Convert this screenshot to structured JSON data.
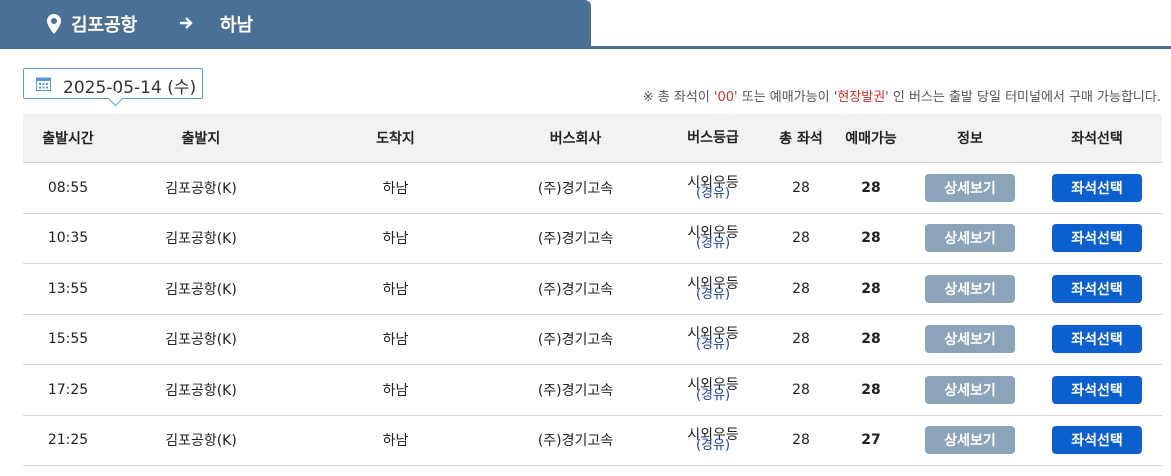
{
  "route": {
    "from": "김포공항",
    "to": "하남"
  },
  "date": {
    "value": "2025-05-14 (수)"
  },
  "notice": {
    "prefix": "※ 총 좌석이 '",
    "zero": "00",
    "middle": "' 또는 예매가능이 '",
    "onsite": "현장발권",
    "suffix": "' 인 버스는 출발 당일 터미널에서 구매 가능합니다."
  },
  "headers": {
    "time": "출발시간",
    "from": "출발지",
    "to": "도착지",
    "company": "버스회사",
    "grade": "버스등급",
    "total": "총 좌석",
    "available": "예매가능",
    "info": "정보",
    "select": "좌석선택"
  },
  "colors": {
    "route_bar": "#4a7096",
    "detail_button": "#8ca4b9",
    "seat_button": "#0b5fce",
    "notice_red": "#d12f2f",
    "via_blue": "#1f3faa"
  },
  "rows": [
    {
      "time": "08:55",
      "from": "김포공항(K)",
      "to": "하남",
      "company": "(주)경기고속",
      "grade": "시외우등",
      "via": "(경유)",
      "total": "28",
      "available": "28",
      "detail_label": "상세보기",
      "select_label": "좌석선택"
    },
    {
      "time": "10:35",
      "from": "김포공항(K)",
      "to": "하남",
      "company": "(주)경기고속",
      "grade": "시외우등",
      "via": "(경유)",
      "total": "28",
      "available": "28",
      "detail_label": "상세보기",
      "select_label": "좌석선택"
    },
    {
      "time": "13:55",
      "from": "김포공항(K)",
      "to": "하남",
      "company": "(주)경기고속",
      "grade": "시외우등",
      "via": "(경유)",
      "total": "28",
      "available": "28",
      "detail_label": "상세보기",
      "select_label": "좌석선택"
    },
    {
      "time": "15:55",
      "from": "김포공항(K)",
      "to": "하남",
      "company": "(주)경기고속",
      "grade": "시외우등",
      "via": "(경유)",
      "total": "28",
      "available": "28",
      "detail_label": "상세보기",
      "select_label": "좌석선택"
    },
    {
      "time": "17:25",
      "from": "김포공항(K)",
      "to": "하남",
      "company": "(주)경기고속",
      "grade": "시외우등",
      "via": "(경유)",
      "total": "28",
      "available": "28",
      "detail_label": "상세보기",
      "select_label": "좌석선택"
    },
    {
      "time": "21:25",
      "from": "김포공항(K)",
      "to": "하남",
      "company": "(주)경기고속",
      "grade": "시외우등",
      "via": "(경유)",
      "total": "28",
      "available": "27",
      "detail_label": "상세보기",
      "select_label": "좌석선택"
    }
  ]
}
